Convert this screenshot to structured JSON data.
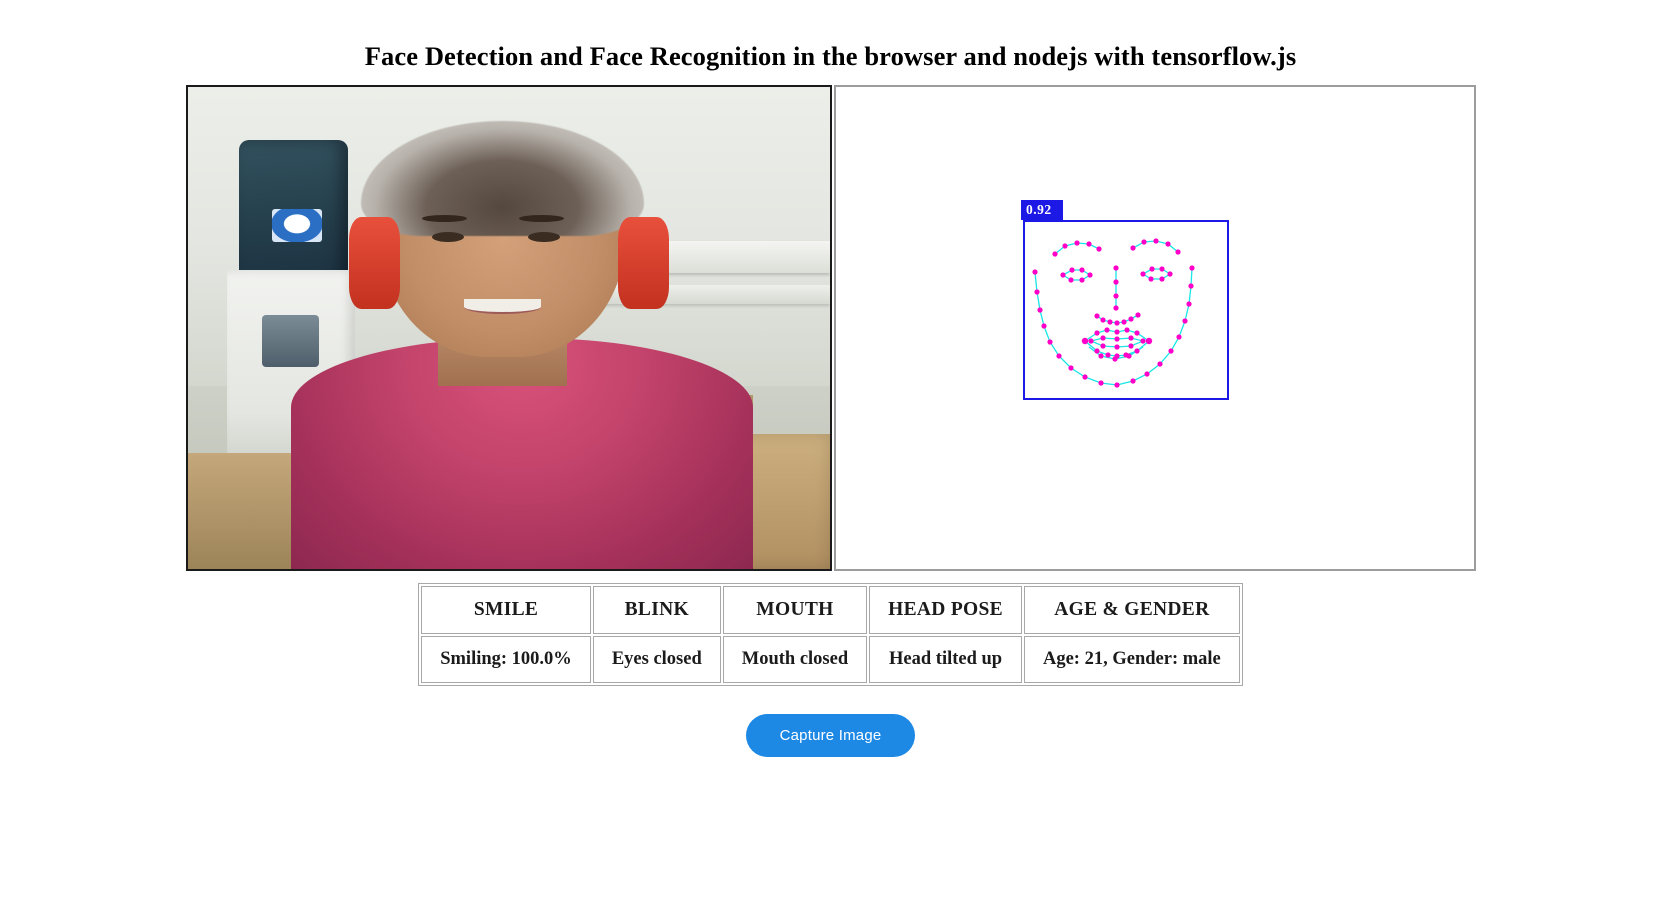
{
  "page": {
    "title": "Face Detection and Face Recognition in the browser and nodejs with tensorflow.js",
    "background_color": "#ffffff"
  },
  "video_panel": {
    "name": "webcam-video-feed",
    "border_color": "#1a1a1a",
    "description_alt": "Webcam view of a smiling man with spiky grey-tipped hair and red headphones in a room with a water dispenser, a shelf of bottles and cardboard boxes"
  },
  "canvas_panel": {
    "name": "face-detection-canvas",
    "border_color": "#9d9d9d",
    "background_color": "#ffffff",
    "detection": {
      "score_label": "0.92",
      "box_color": "#1c18e6",
      "landmark_point_color": "#ff00c8",
      "landmark_line_color": "#19e6e6",
      "score_text_color": "#ffffff"
    }
  },
  "results_table": {
    "headers": [
      "SMILE",
      "BLINK",
      "MOUTH",
      "HEAD POSE",
      "AGE & GENDER"
    ],
    "values": [
      "Smiling: 100.0%",
      "Eyes closed",
      "Mouth closed",
      "Head tilted up",
      "Age: 21, Gender: male"
    ],
    "border_color": "#a8a8a8"
  },
  "capture_button": {
    "label": "Capture Image",
    "background_color": "#1e88e5",
    "text_color": "#ffffff"
  }
}
